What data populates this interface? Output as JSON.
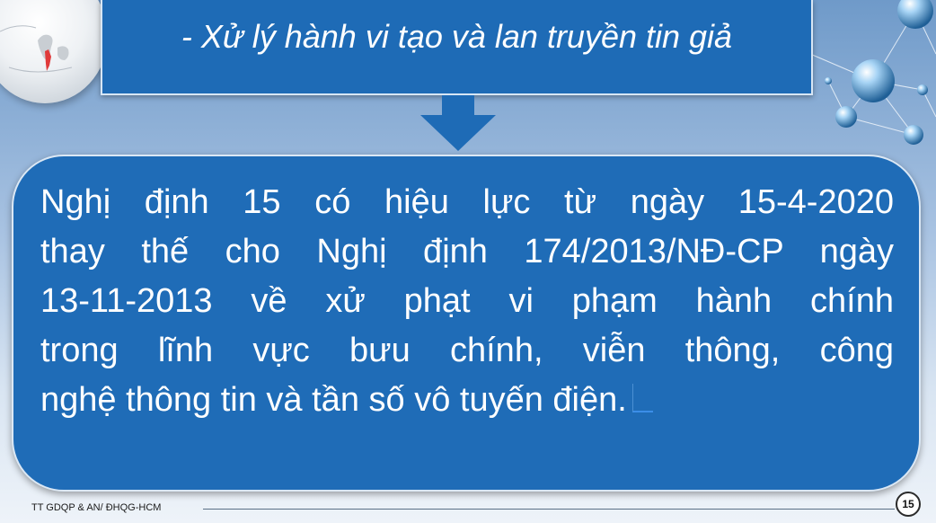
{
  "slide": {
    "title": "- Xử lý hành vi tạo và lan truyền tin giả",
    "body_lines": [
      "Nghị định 15 có hiệu lực từ ngày 15-4-2020",
      "thay thế cho Nghị định 174/2013/NĐ-CP ngày",
      "13-11-2013 về xử phạt vi phạm hành chính",
      "trong lĩnh vực bưu chính, viễn thông, công",
      "nghệ thông tin và tần số vô tuyến điện."
    ],
    "footer": "TT GDQP & AN/ ĐHQG-HCM",
    "page_number": "15"
  },
  "colors": {
    "box_fill": "#1f6cb7",
    "box_border": "#dbe8f5",
    "text": "#ffffff"
  },
  "icons": [
    "globe-icon",
    "network-spheres-icon",
    "arrow-down-icon"
  ]
}
